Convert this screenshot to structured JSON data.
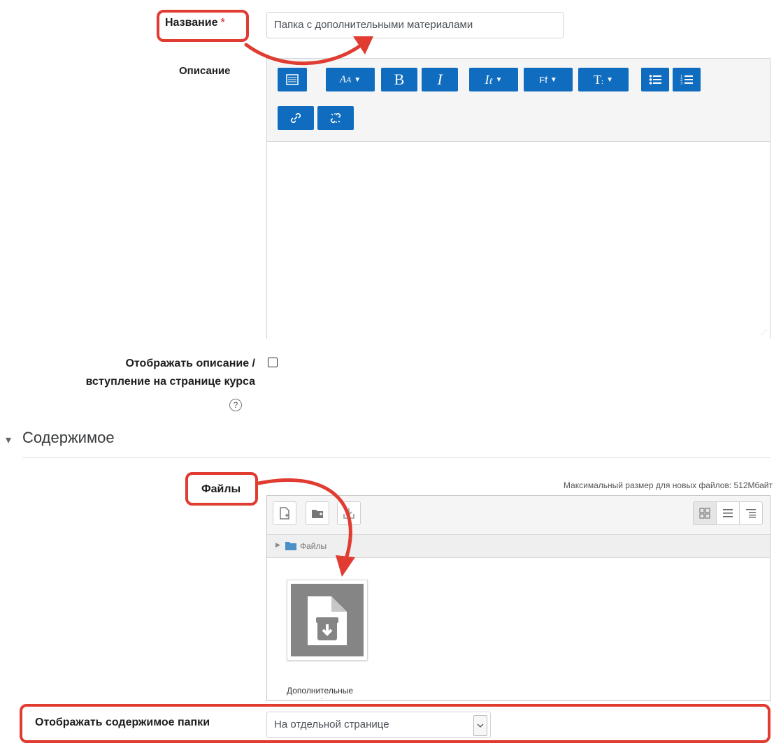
{
  "form": {
    "name_label": "Название",
    "required_mark": "*",
    "name_value": "Папка с дополнительными материалами",
    "description_label": "Описание",
    "show_description_label_line1": "Отображать описание /",
    "show_description_label_line2": "вступление на странице курса",
    "help_glyph": "?"
  },
  "editor": {
    "toolbar_row1": [
      {
        "name": "toolbar-toggle-icon",
        "glyph": "▦"
      },
      {
        "name": "font-size-icon",
        "glyph": "A",
        "caret": true
      },
      {
        "name": "bold-icon",
        "glyph": "B"
      },
      {
        "name": "italic-icon",
        "glyph": "I"
      },
      {
        "name": "text-color-icon",
        "glyph": "I",
        "caret": true
      },
      {
        "name": "font-family-icon",
        "glyph": "Ff",
        "caret": true
      },
      {
        "name": "paragraph-style-icon",
        "glyph": "T",
        "caret": true
      },
      {
        "name": "unordered-list-icon",
        "glyph": "☰"
      },
      {
        "name": "ordered-list-icon",
        "glyph": "☰"
      }
    ],
    "toolbar_row2": [
      {
        "name": "link-icon",
        "glyph": "🔗"
      },
      {
        "name": "unlink-icon",
        "glyph": "✂"
      }
    ],
    "content": ""
  },
  "content_section": {
    "title": "Содержимое",
    "collapse_glyph": "▾"
  },
  "files": {
    "label": "Файлы",
    "max_size_text": "Максимальный размер для новых файлов: 512Мбайт",
    "path_label": "Файлы",
    "file_name": "Дополнительные",
    "file_name_overflow": "."
  },
  "display": {
    "label": "Отображать содержимое папки",
    "selected": "На отдельной странице"
  },
  "colors": {
    "accent": "#0f6cbf",
    "callout": "#e03c31"
  }
}
